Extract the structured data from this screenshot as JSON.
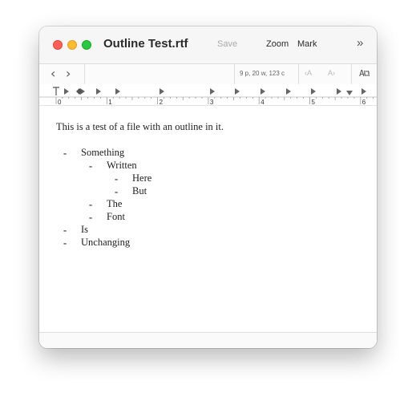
{
  "window": {
    "title": "Outline Test.rtf"
  },
  "toolbar": {
    "save_label": "Save",
    "zoom_label": "Zoom",
    "mark_label": "Mark",
    "more_label": "»",
    "back_icon": "chevron-left-icon",
    "forward_icon": "chevron-right-icon",
    "stats": "9 p, 20 w, 123 c",
    "font_smaller_label": "‹A",
    "font_larger_label": "A›",
    "format_icon": "text-format-icon"
  },
  "ruler": {
    "numbers": [
      "0",
      "1",
      "2",
      "3",
      "4",
      "5",
      "6"
    ]
  },
  "document": {
    "paragraph": "This is a test of a file with an outline in it.",
    "bullet_char": "-",
    "outline": [
      {
        "level": 1,
        "text": "Something"
      },
      {
        "level": 2,
        "text": "Written"
      },
      {
        "level": 3,
        "text": "Here"
      },
      {
        "level": 3,
        "text": "But"
      },
      {
        "level": 2,
        "text": "The"
      },
      {
        "level": 2,
        "text": "Font"
      },
      {
        "level": 1,
        "text": "Is"
      },
      {
        "level": 1,
        "text": "Unchanging"
      }
    ]
  },
  "colors": {
    "close": "#ff5f57",
    "minimize": "#febc2e",
    "zoom": "#28c840"
  }
}
